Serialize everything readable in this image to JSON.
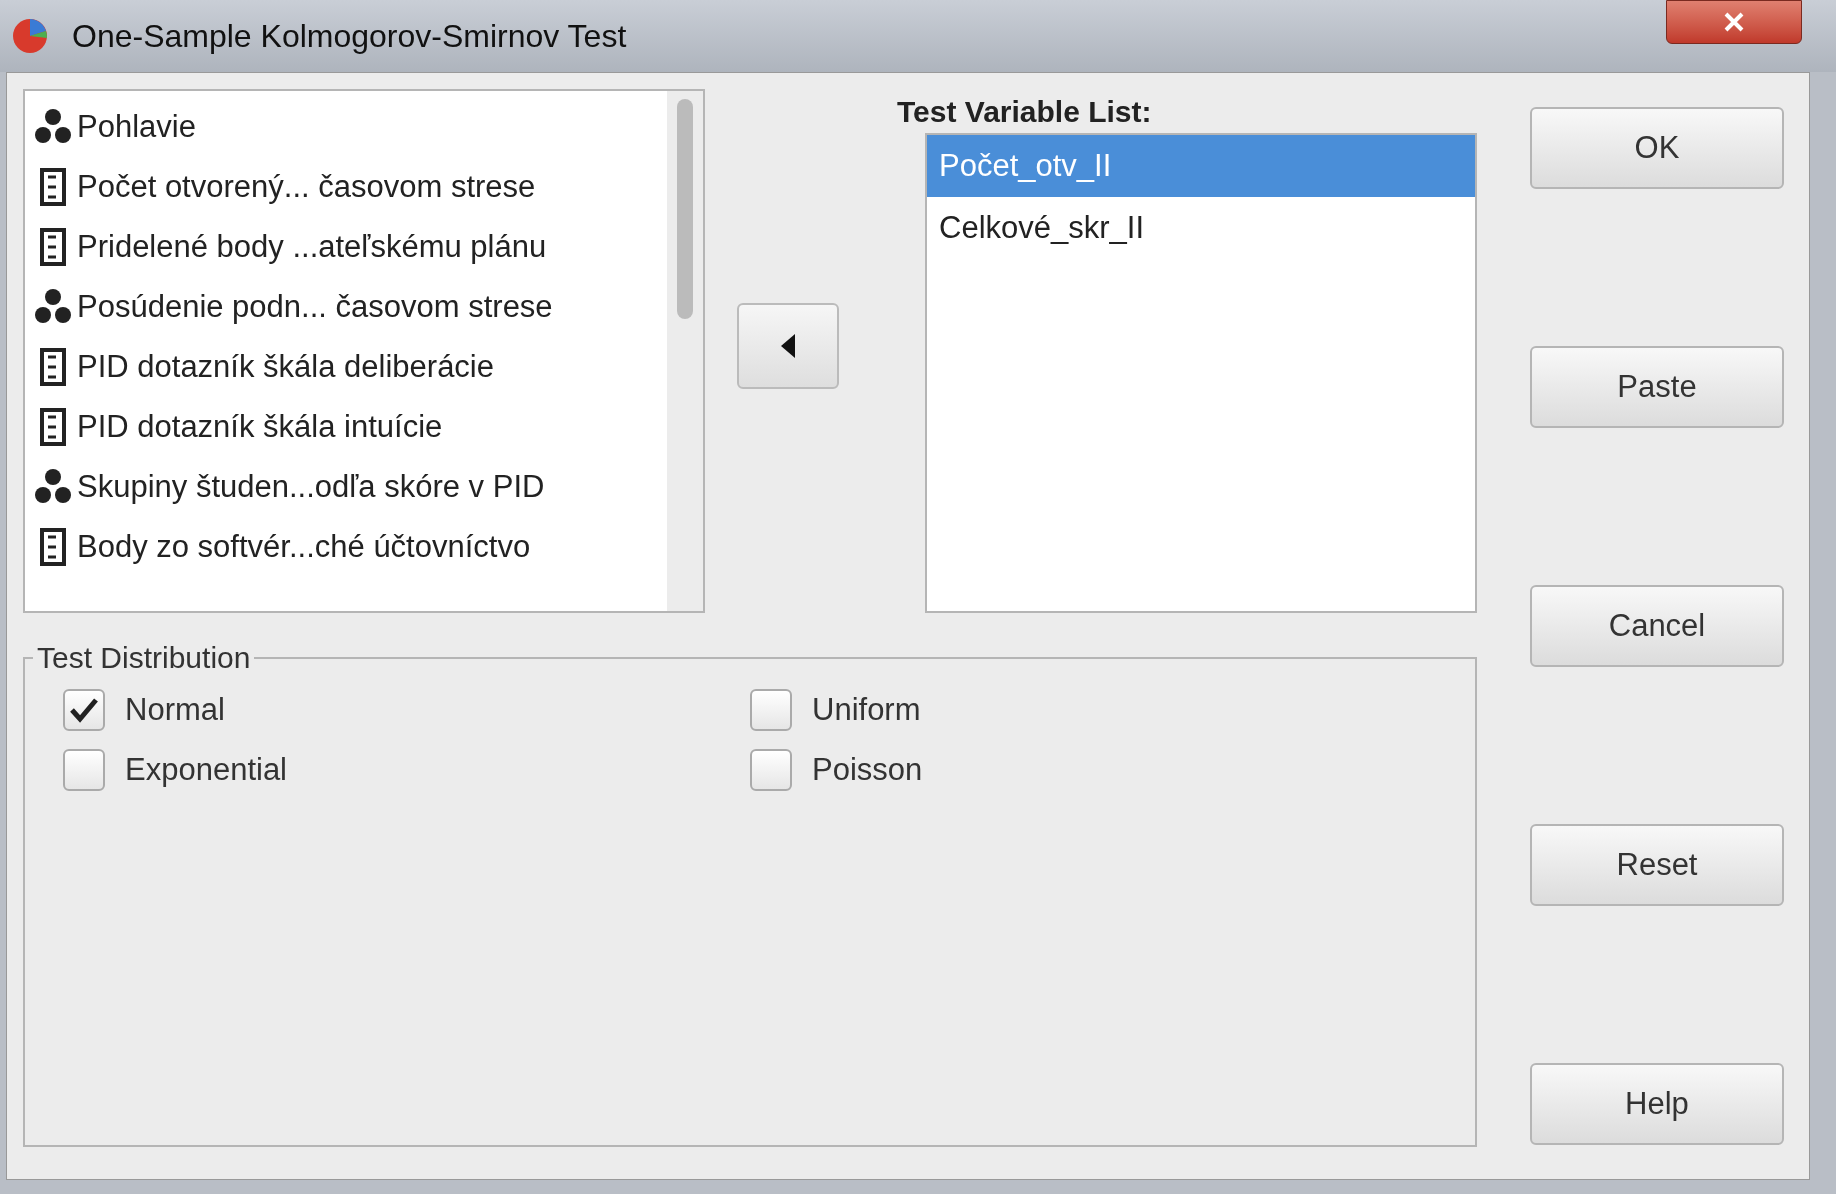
{
  "window": {
    "title": "One-Sample Kolmogorov-Smirnov Test"
  },
  "source_variables": [
    {
      "kind": "nominal",
      "label": "Pohlavie"
    },
    {
      "kind": "scale",
      "label": "Počet otvorený... časovom strese"
    },
    {
      "kind": "scale",
      "label": "Pridelené body ...ateľskému plánu"
    },
    {
      "kind": "nominal",
      "label": "Posúdenie podn... časovom strese"
    },
    {
      "kind": "scale",
      "label": "PID dotazník škála deliberácie"
    },
    {
      "kind": "scale",
      "label": "PID dotazník škála intuície"
    },
    {
      "kind": "nominal",
      "label": "Skupiny študen...odľa skóre v PID"
    },
    {
      "kind": "scale",
      "label": "Body zo softvér...ché účtovníctvo"
    }
  ],
  "test_variable_list": {
    "label": "Test Variable List:",
    "items": [
      {
        "label": "Počet_otv_II",
        "selected": true
      },
      {
        "label": "Celkové_skr_II",
        "selected": false
      }
    ]
  },
  "test_distribution": {
    "title": "Test Distribution",
    "options": [
      {
        "label": "Normal",
        "checked": true
      },
      {
        "label": "Uniform",
        "checked": false
      },
      {
        "label": "Exponential",
        "checked": false
      },
      {
        "label": "Poisson",
        "checked": false
      }
    ]
  },
  "buttons": [
    "OK",
    "Paste",
    "Cancel",
    "Reset",
    "Help"
  ]
}
